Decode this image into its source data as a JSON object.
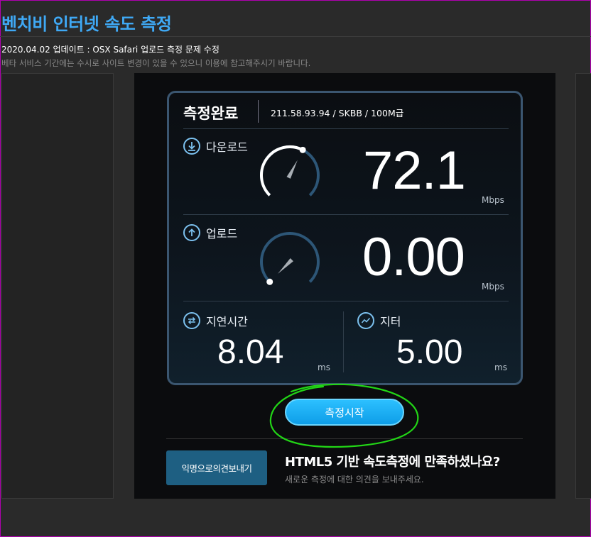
{
  "page": {
    "title": "벤치비 인터넷 속도 측정",
    "notice_update": "2020.04.02 업데이트 : OSX Safari 업로드 측정 문제 수정",
    "notice_beta": "베타 서비스 기간에는 수시로 사이트 변경이 있을 수 있으니 이용에 참고해주시기 바랍니다."
  },
  "card": {
    "status": "측정완료",
    "server": "211.58.93.94 / SKBB / 100M급"
  },
  "download": {
    "label": "다운로드",
    "value": "72.1",
    "unit": "Mbps",
    "gauge_level": 0.6
  },
  "upload": {
    "label": "업로드",
    "value": "0.00",
    "unit": "Mbps",
    "gauge_level": 0.0
  },
  "latency": {
    "label": "지연시간",
    "value": "8.04",
    "unit": "ms"
  },
  "jitter": {
    "label": "지터",
    "value": "5.00",
    "unit": "ms"
  },
  "start_button": {
    "label": "측정시작"
  },
  "feedback": {
    "button_label": "익명으로의견보내기",
    "title": "HTML5 기반 속도측정에 만족하셨나요?",
    "subtitle": "새로운 측정에 대한 의견을 보내주세요."
  },
  "colors": {
    "accent": "#3fa9f5",
    "button": "#14a8f0",
    "annotation": "#22d616"
  },
  "icons": [
    "download-icon",
    "upload-icon",
    "latency-icon",
    "jitter-icon"
  ]
}
